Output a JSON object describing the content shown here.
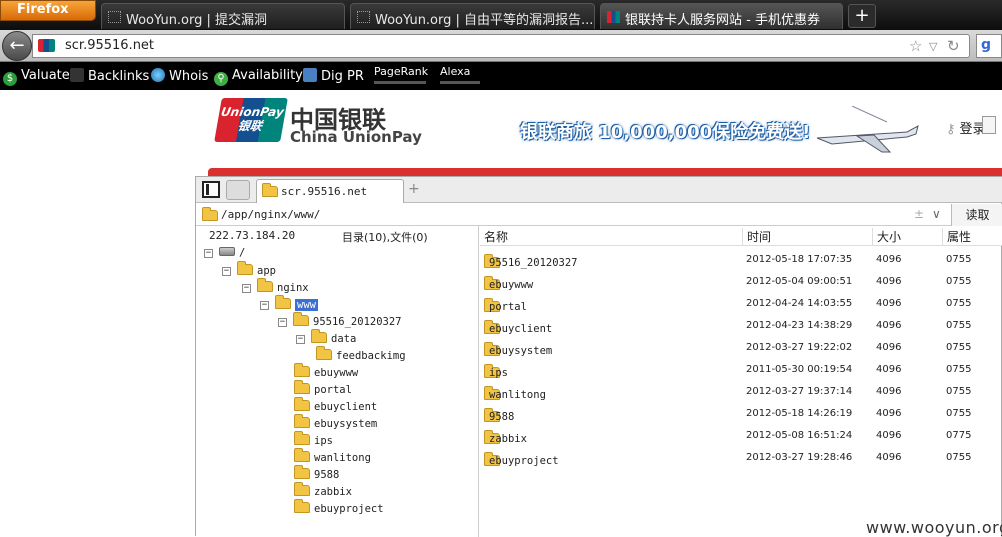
{
  "browser": {
    "menu_button": "Firefox",
    "tabs": [
      {
        "title": "WooYun.org | 提交漏洞"
      },
      {
        "title": "WooYun.org | 自由平等的漏洞报告..."
      },
      {
        "title": "银联持卡人服务网站 - 手机优惠券"
      }
    ],
    "new_tab": "+",
    "address": "scr.95516.net",
    "toolbar": {
      "valuate": "Valuate",
      "backlinks": "Backlinks",
      "whois": "Whois",
      "availability": "Availability",
      "dig_pr": "Dig PR",
      "pagerank": "PageRank",
      "pagerank_level": 0.6,
      "alexa": "Alexa",
      "alexa_level": 0.5
    }
  },
  "site": {
    "logo_en": "UnionPay",
    "logo_cn_small": "银联",
    "brand_cn": "中国银联",
    "brand_en": "China UnionPay",
    "banner_text": "银联商旅 10,000,000保险免费送!",
    "login": "登录"
  },
  "filemanager": {
    "tab_label": "scr.95516.net",
    "tab_add": "+",
    "path": "/app/nginx/www/",
    "path_plusminus": "±",
    "path_dropdown": "∨",
    "read_button": "读取",
    "ip": "222.73.184.20",
    "counts": "目录(10),文件(0)",
    "tree": [
      {
        "label": "/",
        "toggle": "−",
        "drive": true
      },
      {
        "label": "app",
        "toggle": "−"
      },
      {
        "label": "nginx",
        "toggle": "−"
      },
      {
        "label": "www",
        "toggle": "−",
        "selected": true
      },
      {
        "label": "95516_20120327",
        "toggle": "−"
      },
      {
        "label": "data",
        "toggle": "−"
      },
      {
        "label": "feedbackimg"
      },
      {
        "label": "ebuywww"
      },
      {
        "label": "portal"
      },
      {
        "label": "ebuyclient"
      },
      {
        "label": "ebuysystem"
      },
      {
        "label": "ips"
      },
      {
        "label": "wanlitong"
      },
      {
        "label": "9588"
      },
      {
        "label": "zabbix"
      },
      {
        "label": "ebuyproject"
      }
    ],
    "columns": {
      "name": "名称",
      "time": "时间",
      "size": "大小",
      "attr": "属性"
    },
    "rows": [
      {
        "name": "95516_20120327",
        "time": "2012-05-18 17:07:35",
        "size": "4096",
        "attr": "0755"
      },
      {
        "name": "ebuywww",
        "time": "2012-05-04 09:00:51",
        "size": "4096",
        "attr": "0755"
      },
      {
        "name": "portal",
        "time": "2012-04-24 14:03:55",
        "size": "4096",
        "attr": "0755"
      },
      {
        "name": "ebuyclient",
        "time": "2012-04-23 14:38:29",
        "size": "4096",
        "attr": "0755"
      },
      {
        "name": "ebuysystem",
        "time": "2012-03-27 19:22:02",
        "size": "4096",
        "attr": "0755"
      },
      {
        "name": "ips",
        "time": "2011-05-30 00:19:54",
        "size": "4096",
        "attr": "0755"
      },
      {
        "name": "wanlitong",
        "time": "2012-03-27 19:37:14",
        "size": "4096",
        "attr": "0755"
      },
      {
        "name": "9588",
        "time": "2012-05-18 14:26:19",
        "size": "4096",
        "attr": "0755"
      },
      {
        "name": "zabbix",
        "time": "2012-05-08 16:51:24",
        "size": "4096",
        "attr": "0775"
      },
      {
        "name": "ebuyproject",
        "time": "2012-03-27 19:28:46",
        "size": "4096",
        "attr": "0755"
      }
    ]
  },
  "watermark": "www.wooyun.org"
}
